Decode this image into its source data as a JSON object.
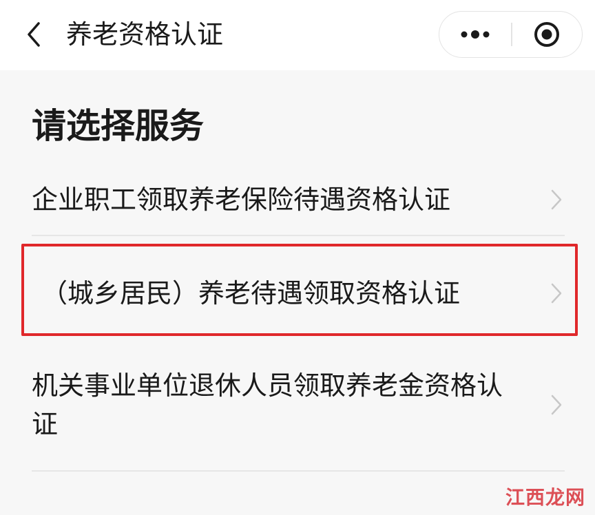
{
  "header": {
    "title": "养老资格认证",
    "back_icon": "chevron-left-icon",
    "more_icon": "more-dots-icon",
    "close_icon": "target-circle-icon"
  },
  "section": {
    "title": "请选择服务"
  },
  "services": [
    {
      "label": "企业职工领取养老保险待遇资格认证"
    },
    {
      "label": "（城乡居民）养老待遇领取资格认证",
      "highlighted": true
    },
    {
      "label": "机关事业单位退休人员领取养老金资格认证"
    }
  ],
  "colors": {
    "highlight": "#e0282b",
    "text": "#1a1a1a",
    "chevron": "#c7c7c7",
    "background": "#f7f7f7",
    "header": "#ffffff"
  },
  "watermark": {
    "text": "江西龙网"
  }
}
